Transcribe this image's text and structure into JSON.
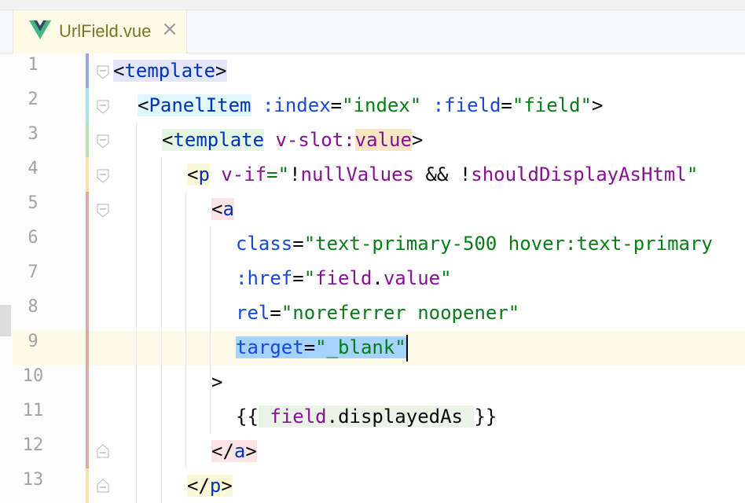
{
  "tab": {
    "filename": "UrlField.vue",
    "icon": "vue-logo-icon",
    "close_icon": "close-icon",
    "close_glyph": "×"
  },
  "editor": {
    "line_numbers": [
      "1",
      "2",
      "3",
      "4",
      "5",
      "6",
      "7",
      "8",
      "9",
      "10",
      "11",
      "12",
      "13"
    ],
    "current_line": 9,
    "lines": {
      "l1": {
        "lt": "<",
        "tag": "template",
        "gt": ">"
      },
      "l2": {
        "lt": "<",
        "tag": "PanelItem",
        "a1": " :index",
        "eq1": "=",
        "v1": "\"index\"",
        "a2": " :field",
        "eq2": "=",
        "v2": "\"field\"",
        "gt": ">"
      },
      "l3": {
        "lt": "<",
        "tag": "template",
        "a1": " v-slot:",
        "slot": "value",
        "gt": ">"
      },
      "l4": {
        "lt": "<",
        "tag": "p",
        "a1": " v-if",
        "eq": "=",
        "q": "\"",
        "bang1": "!",
        "p1": "nullValues",
        "amp": " && ",
        "bang2": "!",
        "p2": "shouldDisplayAsHtml",
        "q2": "\""
      },
      "l5": {
        "lt": "<",
        "tag": "a"
      },
      "l6": {
        "attr": "class",
        "eq": "=",
        "val": "\"text-primary-500 hover:text-primary"
      },
      "l7": {
        "attr": ":href",
        "eq": "=",
        "q1": "\"",
        "obj": "field",
        "dot": ".",
        "prop": "value",
        "q2": "\""
      },
      "l8": {
        "attr": "rel",
        "eq": "=",
        "val": "\"noreferrer noopener\""
      },
      "l9": {
        "attr": "target",
        "eq": "=",
        "val": "\"_blank\""
      },
      "l10": {
        "gt": ">"
      },
      "l11": {
        "open": "{{",
        "sp": " ",
        "obj": "field",
        "dot": ".",
        "prop": "displayedAs",
        "sp2": " ",
        "close": "}}"
      },
      "l12": {
        "lt": "</",
        "tag": "a",
        "gt": ">"
      },
      "l13": {
        "lt": "</",
        "tag": "p",
        "gt": ">"
      }
    }
  },
  "colors": {
    "tag": "#0033b3",
    "attribute": "#174ad4",
    "string": "#067d17",
    "property": "#871094",
    "selection": "#a6d2ff",
    "caret_line": "#fdfbe8",
    "tab_active": "#fdfbe5",
    "tab_text": "#7c7428"
  }
}
